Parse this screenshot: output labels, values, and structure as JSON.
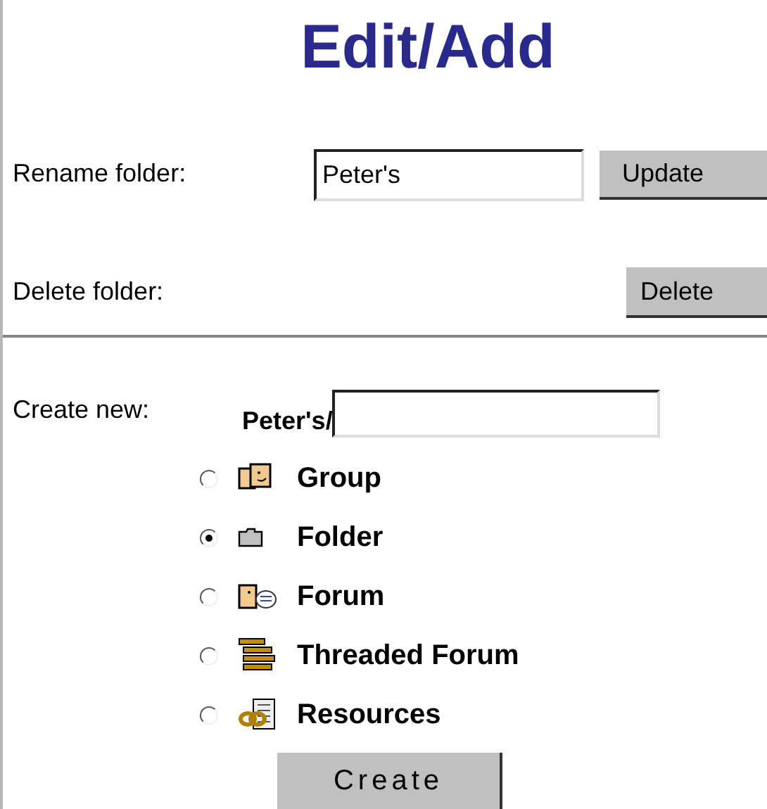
{
  "title": "Edit/Add",
  "rename": {
    "label": "Rename folder:",
    "value": "Peter's",
    "button": "Update"
  },
  "delete": {
    "label": "Delete folder:",
    "button": "Delete"
  },
  "create": {
    "label": "Create new:",
    "prefix": "Peter's/",
    "options": [
      {
        "kind": "group",
        "label": "Group",
        "selected": false
      },
      {
        "kind": "folder",
        "label": "Folder",
        "selected": true
      },
      {
        "kind": "forum",
        "label": "Forum",
        "selected": false
      },
      {
        "kind": "threaded",
        "label": "Threaded Forum",
        "selected": false
      },
      {
        "kind": "resources",
        "label": "Resources",
        "selected": false
      }
    ],
    "button": "Create"
  }
}
